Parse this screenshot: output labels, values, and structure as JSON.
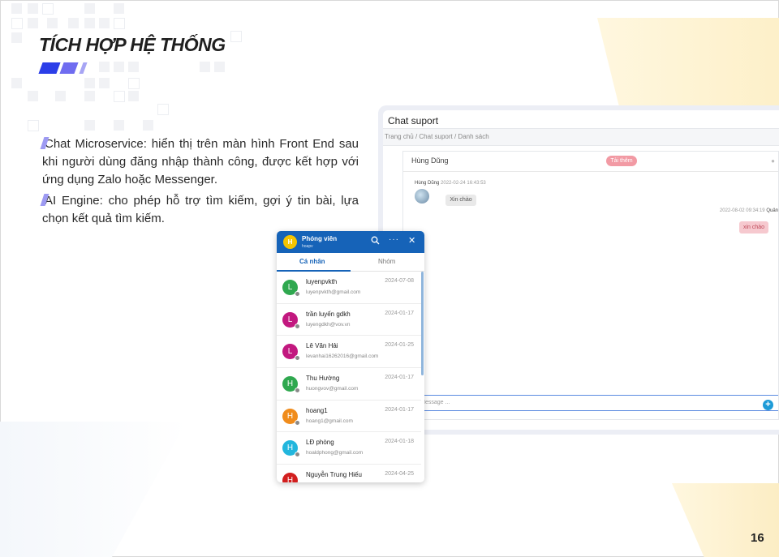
{
  "slide": {
    "title": "TÍCH HỢP HỆ THỐNG",
    "paragraphs": [
      "Chat Microservice: hiển thị trên màn hình Front End sau khi người dùng đăng nhập thành công, được kết hợp với ứng dụng Zalo hoặc Messenger.",
      "AI Engine: cho phép hỗ trợ tìm kiếm, gợi ý tin bài, lựa chọn kết quả tìm kiếm."
    ],
    "page_number": "16",
    "colors": {
      "accent_blue": "#2b3ee8",
      "accent_violet": "#6f6cf0",
      "accent_lilac": "#a7a5f4",
      "accent_yellow": "#fdf0c9"
    }
  },
  "chat_support": {
    "title": "Chat suport",
    "breadcrumb": "Trang chủ / Chat suport / Danh sách",
    "contact_name": "Hùng Dũng",
    "tag_label": "Tải thêm",
    "incoming": {
      "sender": "Hùng Dũng",
      "time": "2022-02-24 16:43:53",
      "text": "Xin chào"
    },
    "outgoing": {
      "time": "2022-08-02 09:34:19",
      "sender": "Quản",
      "text": "xin chào"
    },
    "input_placeholder": "Type Message ...",
    "send_icon": "plus-icon"
  },
  "chat_widget": {
    "header": {
      "avatar_letter": "H",
      "name": "Phóng viên",
      "subtitle": "hoapv",
      "icons": [
        "search-icon",
        "more-icon",
        "close-icon"
      ]
    },
    "tabs": [
      "Cá nhân",
      "Nhóm"
    ],
    "active_tab": "Cá nhân",
    "contacts": [
      {
        "letter": "L",
        "name": "luyenpvkth",
        "email": "luyenpvkth@gmail.com",
        "date": "2024-07-08",
        "color": "#2fa84f"
      },
      {
        "letter": "L",
        "name": "trần luyến gdkh",
        "email": "luyengdkh@vov.vn",
        "date": "2024-01-17",
        "color": "#c2187f"
      },
      {
        "letter": "L",
        "name": "Lê Văn Hải",
        "email": "levanhai16262016@gmail.com",
        "date": "2024-01-25",
        "color": "#c2187f"
      },
      {
        "letter": "H",
        "name": "Thu Hường",
        "email": "huongvov@gmail.com",
        "date": "2024-01-17",
        "color": "#2fa84f"
      },
      {
        "letter": "H",
        "name": "hoang1",
        "email": "hoang1@gmail.com",
        "date": "2024-01-17",
        "color": "#f08c1c"
      },
      {
        "letter": "H",
        "name": "LĐ phòng",
        "email": "hoaldphong@gmail.com",
        "date": "2024-01-18",
        "color": "#22b6dd"
      },
      {
        "letter": "H",
        "name": "Nguyễn Trung Hiếu",
        "email": "",
        "date": "2024-04-25",
        "color": "#d21f1f"
      }
    ]
  }
}
